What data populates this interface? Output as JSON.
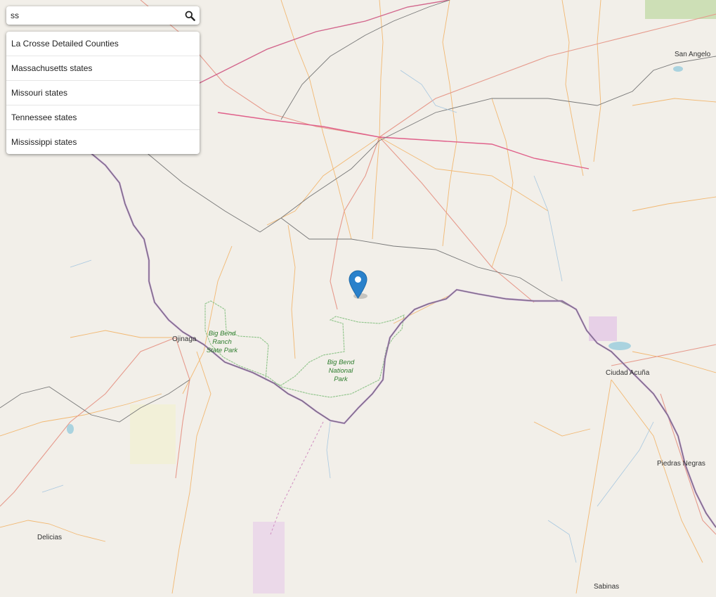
{
  "search": {
    "value": "ss",
    "placeholder": ""
  },
  "results": [
    {
      "label": "La Crosse Detailed Counties"
    },
    {
      "label": "Massachusetts states"
    },
    {
      "label": "Missouri states"
    },
    {
      "label": "Tennessee states"
    },
    {
      "label": "Mississippi states"
    }
  ],
  "map": {
    "cities": {
      "san_angelo": "San Angelo",
      "ojinaga": "Ojinaga",
      "ciudad_acuna": "Ciudad Acuña",
      "piedras_negras": "Piedras Negras",
      "delicias": "Delicias",
      "sabinas": "Sabinas"
    },
    "parks": {
      "big_bend_ranch": [
        "Big Bend",
        "Ranch",
        "State Park"
      ],
      "big_bend_np": [
        "Big Bend",
        "National",
        "Park"
      ]
    },
    "marker_color": "#2a81cb",
    "border_color": "#b48cc8",
    "road_color": "#f0b46e",
    "primary_road_color": "#e07070"
  }
}
